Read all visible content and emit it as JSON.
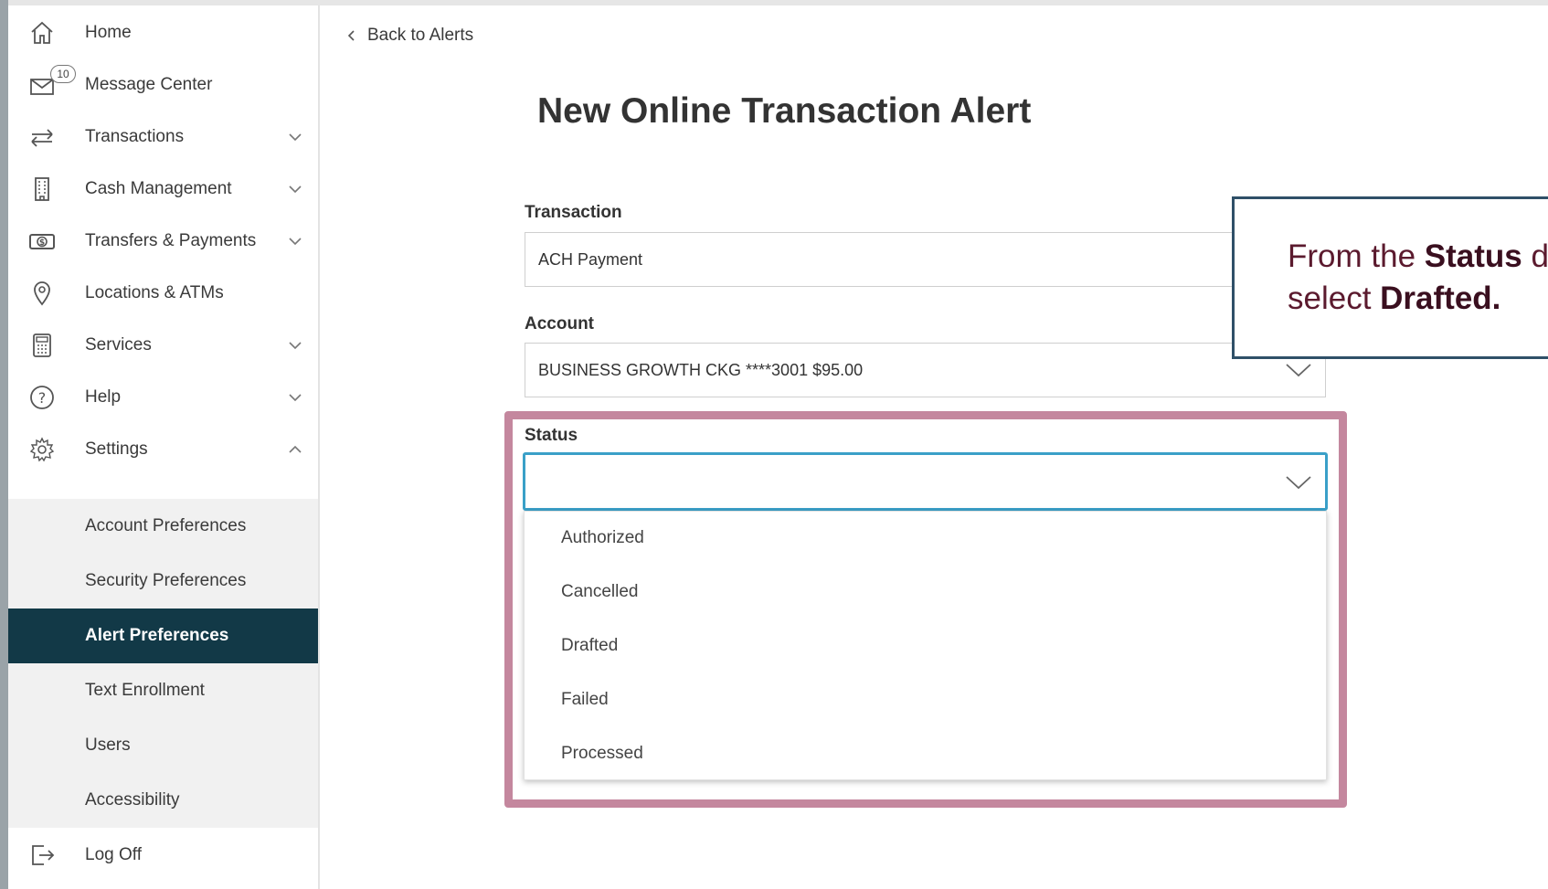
{
  "sidebar": {
    "items": [
      {
        "label": "Home",
        "icon": "home-icon"
      },
      {
        "label": "Message Center",
        "icon": "mail-icon",
        "badge": "10"
      },
      {
        "label": "Transactions",
        "icon": "transfer-arrows-icon",
        "expandable": true
      },
      {
        "label": "Cash Management",
        "icon": "building-icon",
        "expandable": true
      },
      {
        "label": "Transfers & Payments",
        "icon": "dollar-bill-icon",
        "expandable": true
      },
      {
        "label": "Locations & ATMs",
        "icon": "location-pin-icon"
      },
      {
        "label": "Services",
        "icon": "calculator-icon",
        "expandable": true
      },
      {
        "label": "Help",
        "icon": "help-icon",
        "expandable": true
      },
      {
        "label": "Settings",
        "icon": "gear-icon",
        "expanded": true
      }
    ],
    "settings_sub": [
      {
        "label": "Account Preferences"
      },
      {
        "label": "Security Preferences"
      },
      {
        "label": "Alert Preferences",
        "active": true
      },
      {
        "label": "Text Enrollment"
      },
      {
        "label": "Users"
      },
      {
        "label": "Accessibility"
      }
    ],
    "logoff": {
      "label": "Log Off",
      "icon": "logout-icon"
    }
  },
  "main": {
    "back_link": "Back to Alerts",
    "title": "New Online Transaction Alert",
    "transaction": {
      "label": "Transaction",
      "value": "ACH Payment"
    },
    "account": {
      "label": "Account",
      "value": "BUSINESS GROWTH CKG ****3001 $95.00"
    },
    "status": {
      "label": "Status",
      "value": "",
      "options": [
        "Authorized",
        "Cancelled",
        "Drafted",
        "Failed",
        "Processed"
      ]
    }
  },
  "callout": {
    "line1_prefix": "From the ",
    "line1_bold": "Status",
    "line1_suffix": " d",
    "line2_prefix": "select ",
    "line2_bold": "Drafted."
  },
  "colors": {
    "active_nav": "#123947",
    "highlight_border": "#c4879e",
    "focus_border": "#3aa0c8",
    "callout_border": "#2f5068",
    "callout_text": "#5b1a2e"
  }
}
